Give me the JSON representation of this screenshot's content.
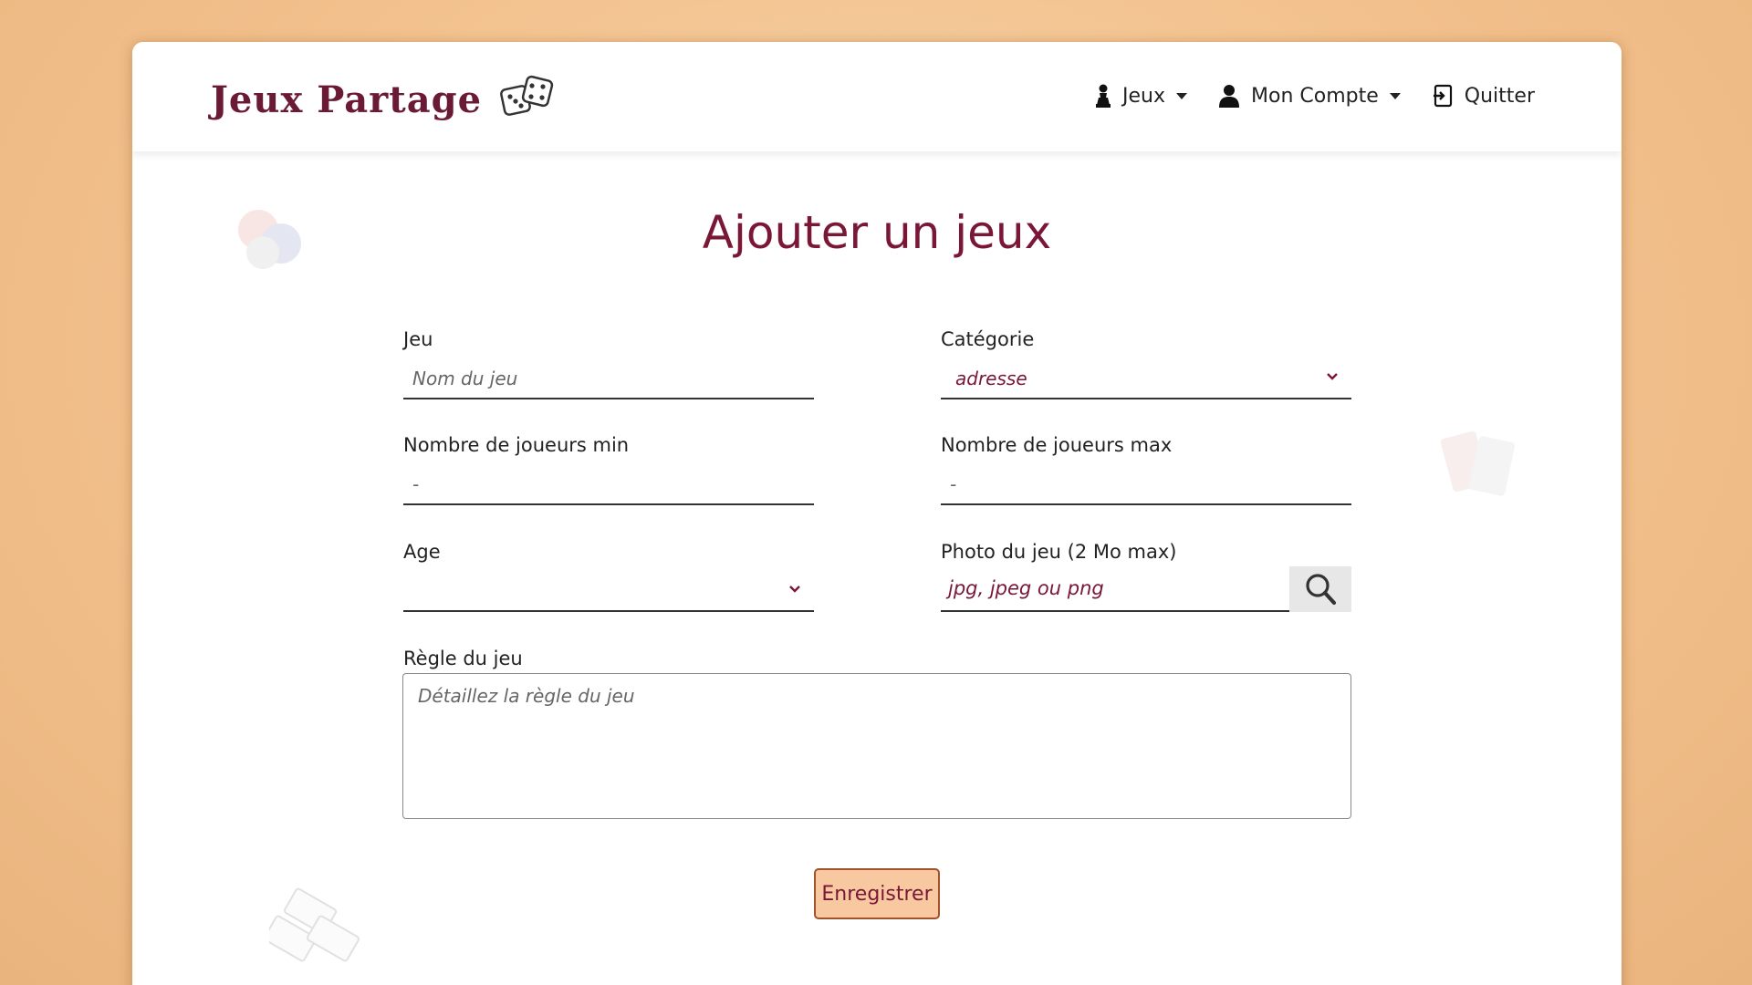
{
  "brand": {
    "name": "Jeux Partage"
  },
  "nav": {
    "jeux": "Jeux",
    "account": "Mon Compte",
    "quit": "Quitter"
  },
  "page": {
    "title": "Ajouter un jeux"
  },
  "form": {
    "jeu_label": "Jeu",
    "jeu_placeholder": "Nom du jeu",
    "categorie_label": "Catégorie",
    "categorie_value": "adresse",
    "min_label": "Nombre de joueurs min",
    "min_placeholder": "-",
    "max_label": "Nombre de joueurs max",
    "max_placeholder": "-",
    "age_label": "Age",
    "age_value": "",
    "photo_label": "Photo du jeu (2 Mo max)",
    "photo_placeholder": "jpg, jpeg ou png",
    "regle_label": "Règle du jeu",
    "regle_placeholder": "Détaillez la règle du jeu",
    "submit": "Enregistrer"
  },
  "colors": {
    "accent": "#7a1736",
    "button_bg": "#f8c9a1",
    "background": "#f2c08c"
  },
  "icons": {
    "logo": "dice-icon",
    "jeux": "pawn-icon",
    "account": "user-icon",
    "quit": "logout-icon",
    "photo": "search-icon"
  }
}
